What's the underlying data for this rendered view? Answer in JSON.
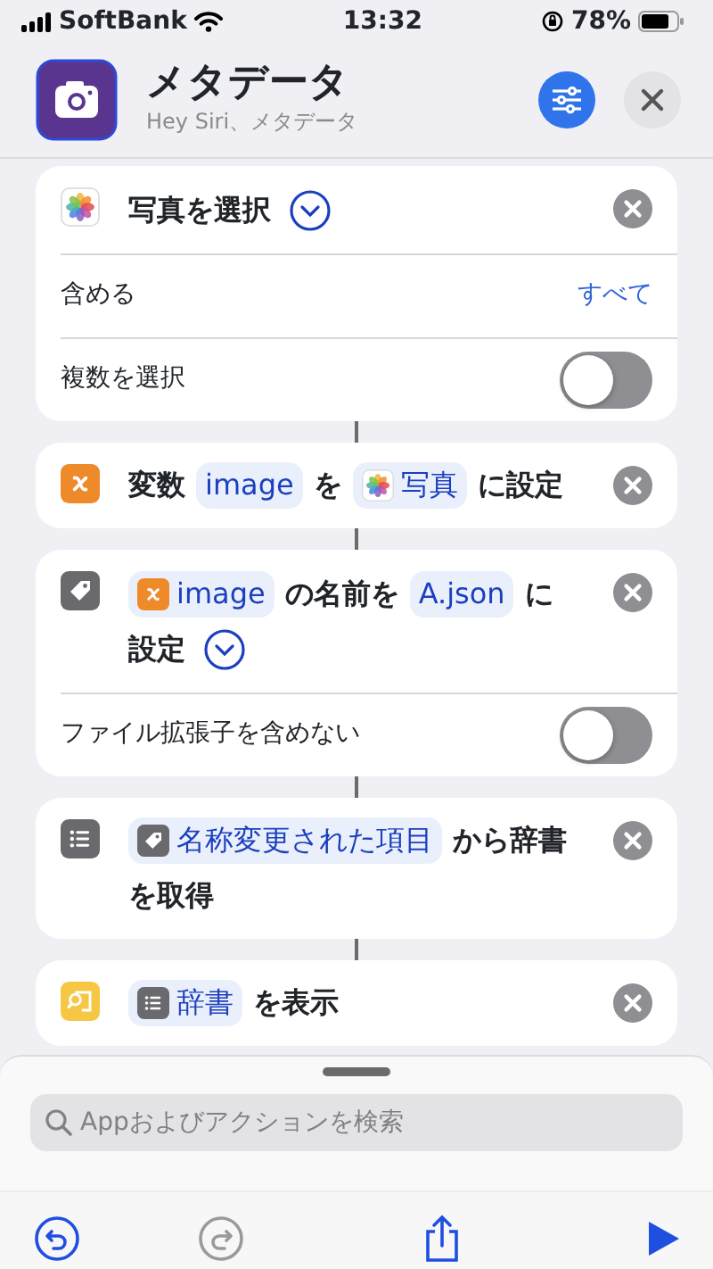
{
  "status_bar": {
    "carrier": "SoftBank",
    "time": "13:32",
    "battery": "78%"
  },
  "header": {
    "title": "メタデータ",
    "subtitle": "Hey Siri、メタデータ"
  },
  "actions": [
    {
      "kind": "photos",
      "parts": [
        {
          "kind": "text",
          "text": "写真を選択",
          "chevron": true
        }
      ],
      "options": [
        {
          "kind": "value",
          "label": "含める",
          "value": "すべて"
        },
        {
          "kind": "toggle",
          "label": "複数を選択",
          "on": false
        }
      ]
    },
    {
      "kind": "variable",
      "parts": [
        {
          "kind": "text",
          "text": "変数"
        },
        {
          "kind": "token",
          "text": "image"
        },
        {
          "kind": "text",
          "text": "を"
        },
        {
          "kind": "photos-token",
          "text": "写真"
        },
        {
          "kind": "text",
          "text": "に設定"
        }
      ]
    },
    {
      "kind": "tag",
      "parts": [
        {
          "kind": "variable-token",
          "text": "image"
        },
        {
          "kind": "text",
          "text": "の名前を"
        },
        {
          "kind": "token",
          "text": "A.json"
        },
        {
          "kind": "text",
          "text": "に"
        },
        {
          "kind": "text",
          "text": "設定",
          "chevron": true
        }
      ],
      "options": [
        {
          "kind": "toggle",
          "label": "ファイル拡張子を含めない",
          "on": false
        }
      ]
    },
    {
      "kind": "list",
      "parts": [
        {
          "kind": "tag-token",
          "text": "名称変更された項目"
        },
        {
          "kind": "text",
          "text": "から辞書"
        },
        {
          "kind": "text",
          "text": "を取得"
        }
      ]
    },
    {
      "kind": "quicklook",
      "parts": [
        {
          "kind": "list-token",
          "text": "辞書"
        },
        {
          "kind": "text",
          "text": "を表示"
        }
      ]
    }
  ],
  "search": {
    "placeholder": "Appおよびアクションを検索"
  },
  "toolbar": [
    {
      "kind": "undo",
      "disabled": false
    },
    {
      "kind": "redo",
      "disabled": true
    },
    {
      "kind": "share",
      "disabled": false
    },
    {
      "kind": "run",
      "disabled": false
    }
  ]
}
